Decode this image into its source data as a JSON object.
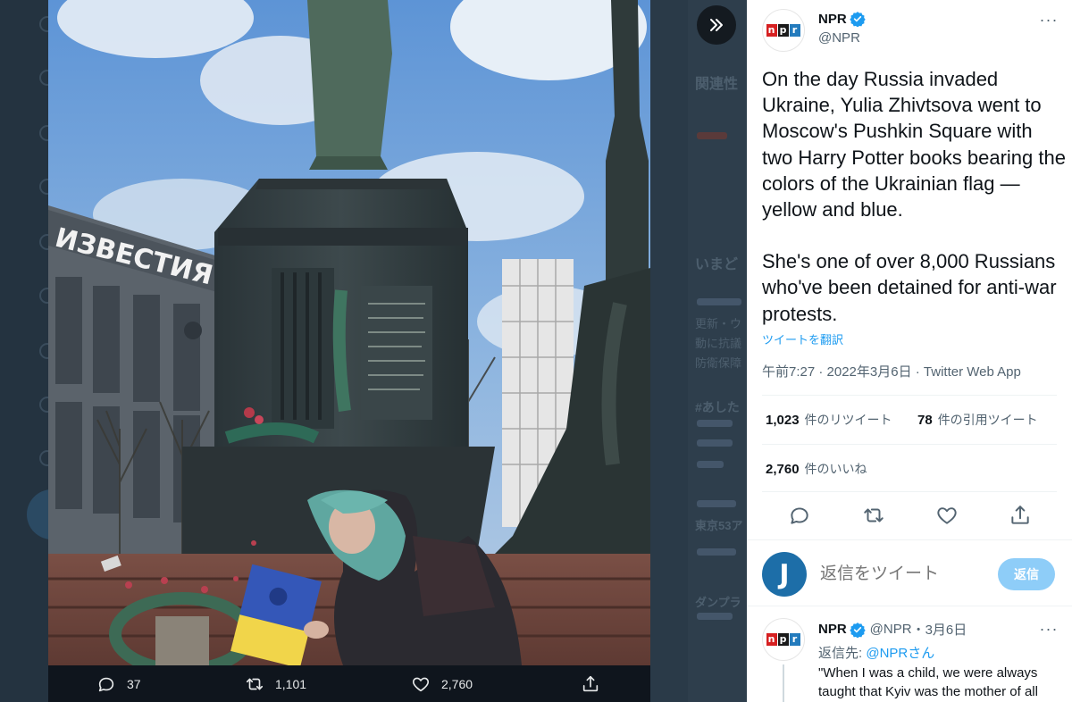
{
  "background_page": {
    "sidebar_text": [
      "関連性",
      "いまど",
      "更新・ウ",
      "動に抗議",
      "防衛保障",
      "#あした",
      "東京53ア",
      "ダンプラ"
    ]
  },
  "photo": {
    "alt_sign": "ИЗВЕСТИЯ",
    "actions": {
      "reply_count": "37",
      "retweet_count": "1,101",
      "like_count": "2,760"
    }
  },
  "tweet": {
    "author_name": "NPR",
    "author_handle": "@NPR",
    "avatar_letters": [
      "n",
      "p",
      "r"
    ],
    "text_paragraph_1": "On the day Russia invaded Ukraine, Yulia Zhivtsova went to Moscow's Pushkin Square with two Harry Potter books bearing the colors of the Ukrainian flag — yellow and blue.",
    "text_paragraph_2": "She's one of over 8,000 Russians who've been detained for anti-war protests.",
    "translate_label": "ツイートを翻訳",
    "timestamp": "午前7:27 · 2022年3月6日 · Twitter Web App",
    "retweets_count": "1,023",
    "retweets_label": "件のリツイート",
    "quotes_count": "78",
    "quotes_label": "件の引用ツイート",
    "likes_count": "2,760",
    "likes_label": "件のいいね"
  },
  "composer": {
    "avatar_letter": "J",
    "placeholder": "返信をツイート",
    "reply_button": "返信"
  },
  "reply": {
    "author_name": "NPR",
    "author_handle": "@NPR",
    "date": "・3月6日",
    "reply_to_prefix": "返信先: ",
    "reply_to_handle": "@NPRさん",
    "text": "\"When I was a child, we were always taught that Kyiv was the mother of all"
  },
  "colors": {
    "accent": "#1d9bf0",
    "reply_button_disabled": "#8ecdf8",
    "muted_text": "#536471"
  }
}
